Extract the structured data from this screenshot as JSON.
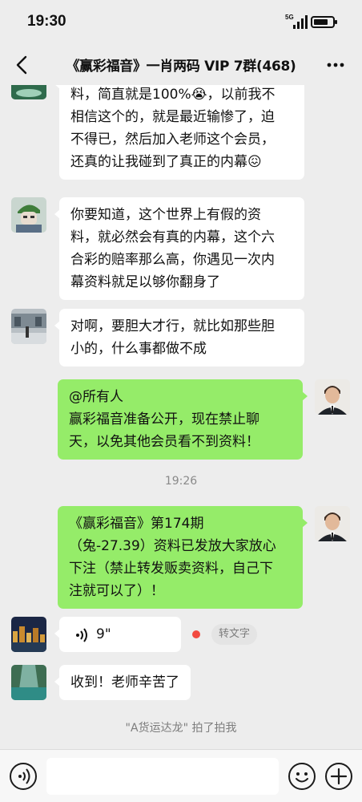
{
  "status_bar": {
    "time": "19:30",
    "network": "5G",
    "battery_level": 0.75
  },
  "header": {
    "title": "《赢彩福音》一肖两码 VIP 7群(468)",
    "back_icon": "back-arrow-icon",
    "more_icon": "more-dots-icon"
  },
  "messages": [
    {
      "side": "left",
      "avatar": "landscape-avatar",
      "lines": [
        "料，简直就是100%😭，以前我不",
        "相信这个的，就是最近输惨了，迫",
        "不得已，然后加入老师这个会员，",
        "还真的让我碰到了真正的内幕😖"
      ]
    },
    {
      "side": "left",
      "avatar": "cartoon-boy-avatar",
      "lines": [
        "你要知道，这个世界上有假的资",
        "料，就必然会有真的内幕，这个六",
        "合彩的赔率那么高，你遇见一次内",
        "幕资料就足以够你翻身了"
      ]
    },
    {
      "side": "left",
      "avatar": "street-photo-avatar",
      "lines": [
        "对啊，要胆大才行，就比如那些胆",
        "小的，什么事都做不成"
      ]
    },
    {
      "side": "right",
      "avatar": "man-in-suit-avatar",
      "lines": [
        "@所有人",
        "赢彩福音准备公开，现在禁止聊",
        "天，以免其他会员看不到资料！"
      ]
    },
    {
      "side": "right",
      "avatar": "man-in-suit-avatar",
      "lines": [
        "《赢彩福音》第174期",
        "（兔-27.39）资料已发放大家放心",
        "下注（禁止转发贩卖资料，自己下",
        "注就可以了）！"
      ]
    },
    {
      "side": "left",
      "avatar": "night-city-avatar",
      "voice_duration": "9\"",
      "transcribe_label": "转文字"
    },
    {
      "side": "left",
      "avatar": "river-canyon-avatar",
      "lines": [
        "收到！老师辛苦了"
      ]
    }
  ],
  "timestamp": "19:26",
  "system_notice": "\"A货运达龙\" 拍了拍我",
  "input_bar": {
    "placeholder": "",
    "voice_icon": "voice-toggle-icon",
    "emoji_icon": "emoji-icon",
    "plus_icon": "plus-icon"
  },
  "colors": {
    "background": "#ededed",
    "sent_bubble": "#95ec69",
    "received_bubble": "#ffffff",
    "unread_dot": "#f2493f"
  }
}
